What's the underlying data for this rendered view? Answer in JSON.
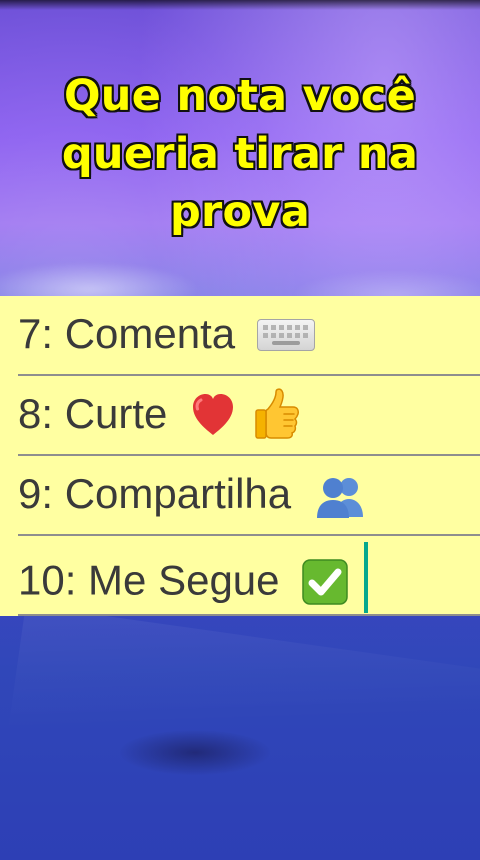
{
  "title": {
    "line1": "Que nota você",
    "line2": "queria tirar na",
    "line3": "prova"
  },
  "items": [
    {
      "label": "7: Comenta",
      "icon": "keyboard-icon"
    },
    {
      "label": "8: Curte",
      "icon": "heart-and-thumbs-up-icon"
    },
    {
      "label": "9: Compartilha",
      "icon": "people-icon"
    },
    {
      "label": "10: Me Segue",
      "icon": "check-mark-icon"
    }
  ],
  "colors": {
    "title_text": "#ffff00",
    "panel_background": "#ffffa1",
    "panel_text": "#3a3a3a",
    "rule_line": "#8e8e8e",
    "cursor": "#06a88d"
  }
}
